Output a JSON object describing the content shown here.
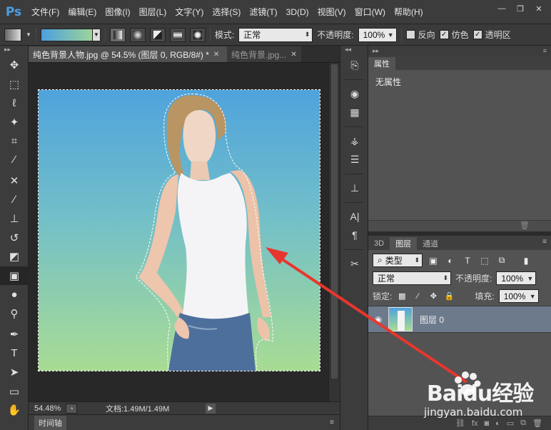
{
  "app": {
    "logo": "Ps"
  },
  "menu": [
    "文件(F)",
    "编辑(E)",
    "图像(I)",
    "图层(L)",
    "文字(Y)",
    "选择(S)",
    "滤镜(T)",
    "3D(D)",
    "视图(V)",
    "窗口(W)",
    "帮助(H)"
  ],
  "window_controls": {
    "minimize": "—",
    "restore": "❐",
    "close": "✕"
  },
  "options": {
    "mode_label": "模式:",
    "mode_value": "正常",
    "opacity_label": "不透明度:",
    "opacity_value": "100%",
    "reverse_label": "反向",
    "dither_label": "仿色",
    "transparency_label": "透明区"
  },
  "document": {
    "active_tab": "纯色背景人物.jpg @ 54.5% (图层 0, RGB/8#) *",
    "inactive_tab": "纯色背景.jpg...",
    "zoom": "54.48%",
    "doc_info": "文档:1.49M/1.49M"
  },
  "timeline": {
    "label": "时间轴"
  },
  "properties": {
    "tab": "属性",
    "body": "无属性"
  },
  "layers": {
    "tabs": [
      "3D",
      "图层",
      "通道"
    ],
    "filter_value": "类型",
    "blend_value": "正常",
    "opacity_label": "不透明度:",
    "opacity_value": "100%",
    "lock_label": "锁定:",
    "fill_label": "填充:",
    "fill_value": "100%",
    "items": [
      {
        "name": "图层 0"
      }
    ]
  },
  "watermark": {
    "brand": "Baidu经验",
    "url": "jingyan.baidu.com"
  },
  "colors": {
    "gradient_start": "#4c9fe0",
    "gradient_end": "#a8dc8f",
    "annotation_arrow": "#e8362e",
    "layer_selected": "#6c7a8c"
  }
}
